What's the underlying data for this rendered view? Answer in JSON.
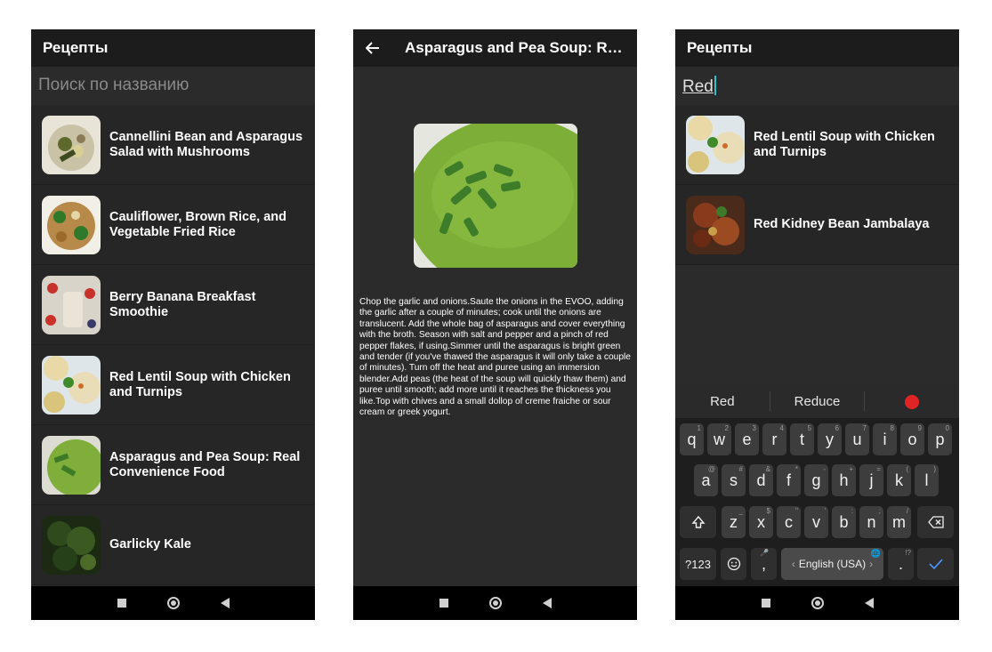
{
  "screen_list": {
    "title": "Рецепты",
    "search_placeholder": "Поиск по названию",
    "items": [
      {
        "title": "Cannellini Bean and Asparagus Salad with Mushrooms"
      },
      {
        "title": "Cauliflower, Brown Rice, and Vegetable Fried Rice"
      },
      {
        "title": "Berry Banana Breakfast Smoothie"
      },
      {
        "title": "Red Lentil Soup with Chicken and Turnips"
      },
      {
        "title": "Asparagus and Pea Soup: Real Convenience Food"
      },
      {
        "title": "Garlicky Kale"
      }
    ]
  },
  "screen_detail": {
    "title": "Asparagus and Pea Soup: Rea...",
    "instructions": "Chop the garlic and onions.Saute the onions in the EVOO, adding the garlic after a couple of minutes; cook until the onions are translucent. Add the whole bag of asparagus and cover everything with the broth. Season with salt and pepper and a pinch of red pepper flakes, if using.Simmer until the asparagus is bright green and tender (if you've thawed the asparagus it will only take a couple of minutes). Turn off the heat and puree using an immersion blender.Add peas (the heat of the soup will quickly thaw them) and puree until smooth; add more until it reaches the thickness you like.Top with chives and a small dollop of creme fraiche or sour cream or greek yogurt."
  },
  "screen_search": {
    "title": "Рецепты",
    "query": "Red",
    "results": [
      {
        "title": "Red Lentil Soup with Chicken and Turnips"
      },
      {
        "title": "Red Kidney Bean Jambalaya"
      }
    ],
    "suggestions": [
      "Red",
      "Reduce"
    ],
    "keyboard": {
      "row1": [
        [
          "q",
          "1"
        ],
        [
          "w",
          "2"
        ],
        [
          "e",
          "3"
        ],
        [
          "r",
          "4"
        ],
        [
          "t",
          "5"
        ],
        [
          "y",
          "6"
        ],
        [
          "u",
          "7"
        ],
        [
          "i",
          "8"
        ],
        [
          "o",
          "9"
        ],
        [
          "p",
          "0"
        ]
      ],
      "row2": [
        [
          "a",
          "@"
        ],
        [
          "s",
          "#"
        ],
        [
          "d",
          "&"
        ],
        [
          "f",
          "*"
        ],
        [
          "g",
          "-"
        ],
        [
          "h",
          "+"
        ],
        [
          "j",
          "="
        ],
        [
          "k",
          "("
        ],
        [
          "l",
          ")"
        ]
      ],
      "row3": [
        [
          "z",
          "_"
        ],
        [
          "x",
          "$"
        ],
        [
          "c",
          "\""
        ],
        [
          "v",
          "'"
        ],
        [
          "b",
          ":"
        ],
        [
          "n",
          ";"
        ],
        [
          "m",
          "/"
        ]
      ],
      "symbols_label": "?123",
      "comma": ",",
      "space_label": "English (USA)",
      "period": ".",
      "period_hint": "!?"
    }
  },
  "colors": {
    "background": "#2b2b2b",
    "appbar": "#1c1c1c",
    "accent": "#2ec4c4",
    "enter_key": "#4a9bff"
  }
}
